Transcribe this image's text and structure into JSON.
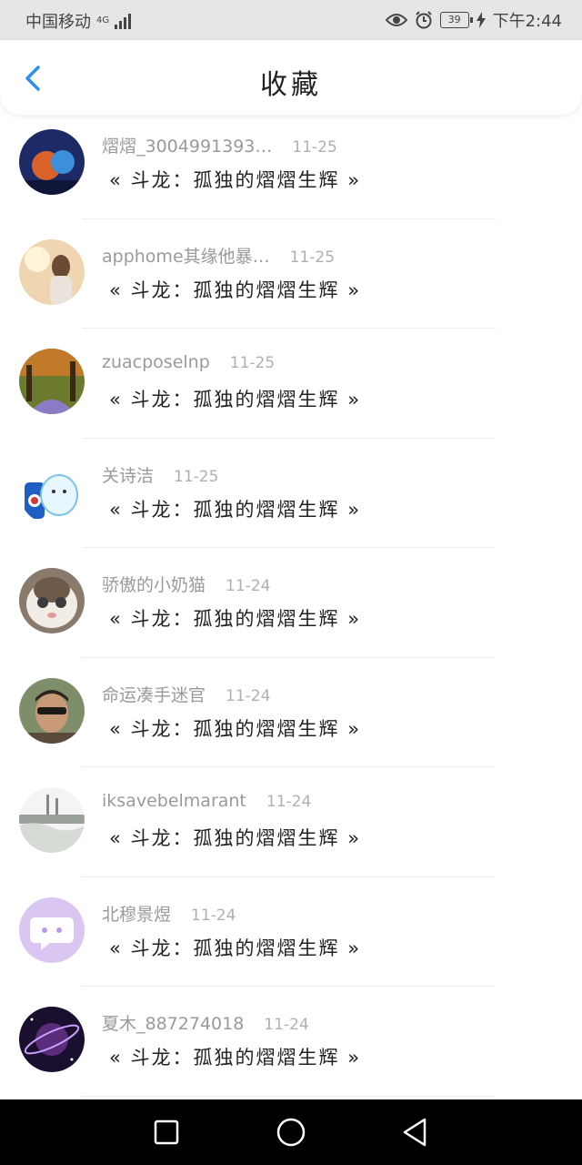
{
  "status_bar": {
    "carrier": "中国移动",
    "network": "4G",
    "battery": "39",
    "time": "下午2:44",
    "icons": [
      "signal-icon",
      "eye-icon",
      "alarm-icon",
      "battery-icon",
      "charging-icon"
    ]
  },
  "header": {
    "title": "收藏",
    "back_icon": "chevron-left-icon"
  },
  "favorites": [
    {
      "name": "熠熠_3004991393…",
      "date": "11-25",
      "text": "« 斗龙：孤独的熠熠生辉 »"
    },
    {
      "name": "apphome其缘他暴…",
      "date": "11-25",
      "text": "« 斗龙：孤独的熠熠生辉 »"
    },
    {
      "name": "zuacposelnp",
      "date": "11-25",
      "text": "« 斗龙：孤独的熠熠生辉 »"
    },
    {
      "name": "关诗洁",
      "date": "11-25",
      "text": "« 斗龙：孤独的熠熠生辉 »"
    },
    {
      "name": "骄傲的小奶猫",
      "date": "11-24",
      "text": "« 斗龙：孤独的熠熠生辉 »"
    },
    {
      "name": "命运凑手迷官",
      "date": "11-24",
      "text": "« 斗龙：孤独的熠熠生辉 »"
    },
    {
      "name": "iksavebelmarant",
      "date": "11-24",
      "text": "« 斗龙：孤独的熠熠生辉 »"
    },
    {
      "name": "北穆景煜",
      "date": "11-24",
      "text": "« 斗龙：孤独的熠熠生辉 »"
    },
    {
      "name": "夏木_887274018",
      "date": "11-24",
      "text": "« 斗龙：孤独的熠熠生辉 »"
    }
  ],
  "nav_bar": {
    "icons": [
      "recent-apps-icon",
      "home-icon",
      "back-icon"
    ]
  },
  "colors": {
    "accent": "#2f8ff0",
    "status_bar_bg": "#e6e6e6",
    "nav_bar_bg": "#000000"
  }
}
